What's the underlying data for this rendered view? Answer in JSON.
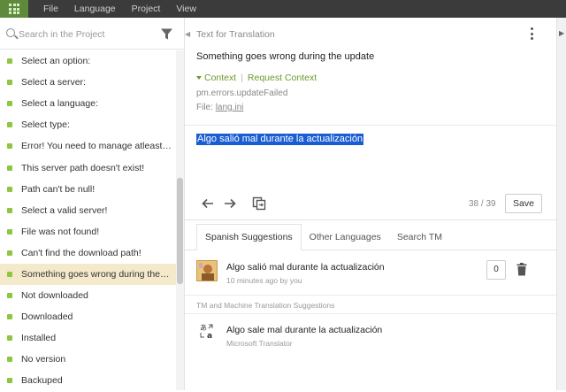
{
  "menu": [
    "File",
    "Language",
    "Project",
    "View"
  ],
  "search": {
    "placeholder": "Search in the Project"
  },
  "strings": [
    "Select an option:",
    "Select a server:",
    "Select a language:",
    "Select type:",
    "Error! You need to manage atleast one server",
    "This server path doesn't exist!",
    "Path can't be null!",
    "Select a valid server!",
    "File was not found!",
    "Can't find the download path!",
    "Something goes wrong during the update",
    "Not downloaded",
    "Downloaded",
    "Installed",
    "No version",
    "Backuped"
  ],
  "active_index": 10,
  "main": {
    "title": "Text for Translation",
    "source": "Something goes wrong during the update",
    "context_label": "Context",
    "request_context_label": "Request Context",
    "key": "pm.errors.updateFailed",
    "file_label": "File:",
    "file_name": "lang.ini",
    "translation": "Algo salió mal durante la actualización",
    "counter": "38 / 39",
    "save_label": "Save"
  },
  "suggestions": {
    "tabs": [
      "Spanish Suggestions",
      "Other Languages",
      "Search TM"
    ],
    "item": {
      "text": "Algo salió mal durante la actualización",
      "meta": "10 minutes ago by you",
      "votes": "0"
    },
    "tm_heading": "TM and Machine Translation Suggestions",
    "mt": {
      "text": "Algo sale mal durante la actualización",
      "source": "Microsoft Translator"
    }
  },
  "colors": {
    "accent": "#8dc63f",
    "selection": "#1a5dd3",
    "active_row": "#f4eacb",
    "topbar": "#3b3b3b"
  }
}
